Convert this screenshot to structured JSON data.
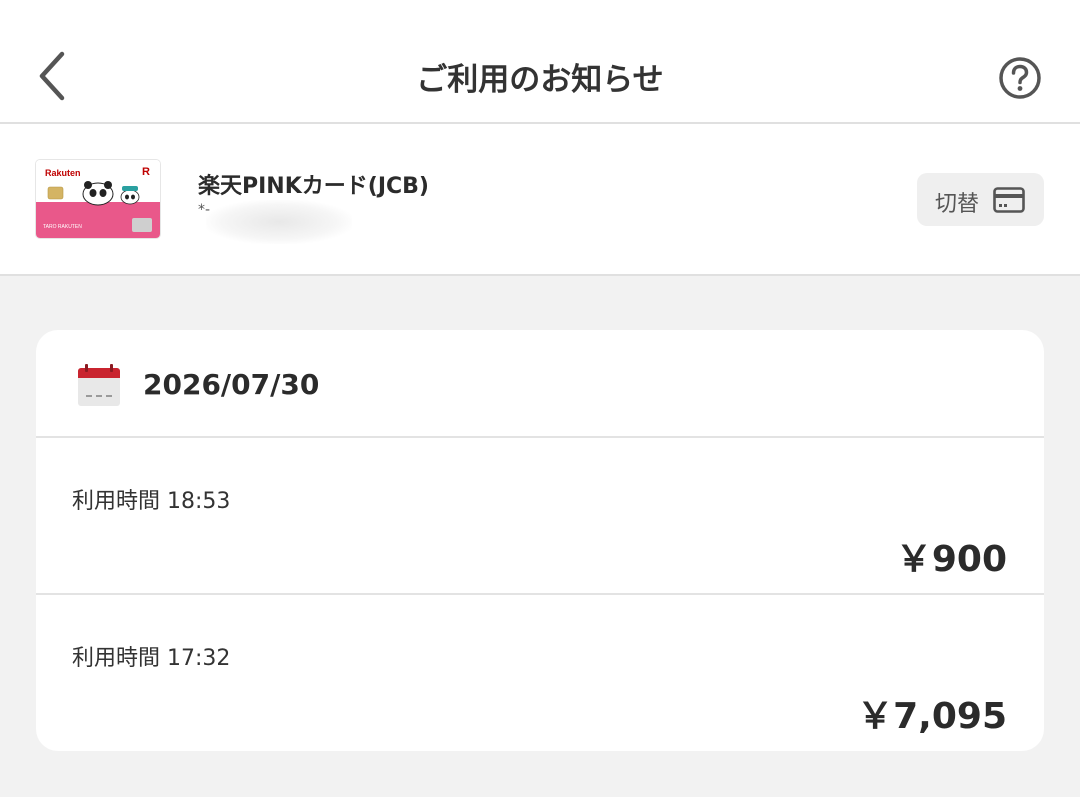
{
  "header": {
    "title": "ご利用のお知らせ",
    "back_icon": "chevron-left-icon",
    "help_icon": "question-circle-icon"
  },
  "card": {
    "name": "楽天PINKカード(JCB)",
    "number_visible": "*-",
    "switch_label": "切替",
    "switch_icon": "credit-card-icon"
  },
  "usage": {
    "date": "2026/07/30",
    "transactions": [
      {
        "time_label": "利用時間 18:53",
        "amount": "￥900"
      },
      {
        "time_label": "利用時間 17:32",
        "amount": "￥7,095"
      }
    ]
  },
  "colors": {
    "background": "#f2f2f2",
    "panel": "#ffffff",
    "text": "#2b2b2b",
    "card_pink": "#e9588a",
    "calendar_red": "#c9242f",
    "rakuten_red": "#bf0000"
  }
}
